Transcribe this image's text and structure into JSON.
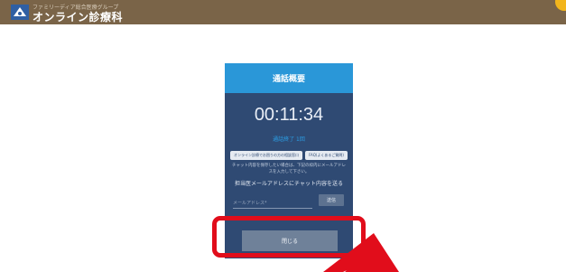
{
  "header": {
    "logo_small_text": "ファミリーディア総合医療グループ",
    "logo_text": "オンライン診療科",
    "bar_color": "#7a6448"
  },
  "card": {
    "title": "通話概要",
    "timer": "00:11:34",
    "status": "通話終了 1回",
    "pills": [
      "オンライン診療でお困りの方の相談窓口",
      "FAQ(よくあるご質問)"
    ],
    "note": "チャット内容を保存したい場合は、下記の枠内にメールアドレスを入力して下さい。",
    "send_label": "担当医メールアドレスにチャット内容を送る",
    "email_placeholder": "メールアドレス*",
    "send_button": "送信",
    "close_button": "閉じる",
    "header_color": "#2a97d8",
    "body_color": "#2f4a73"
  },
  "annotation": {
    "highlight_color": "#e10d1b"
  }
}
